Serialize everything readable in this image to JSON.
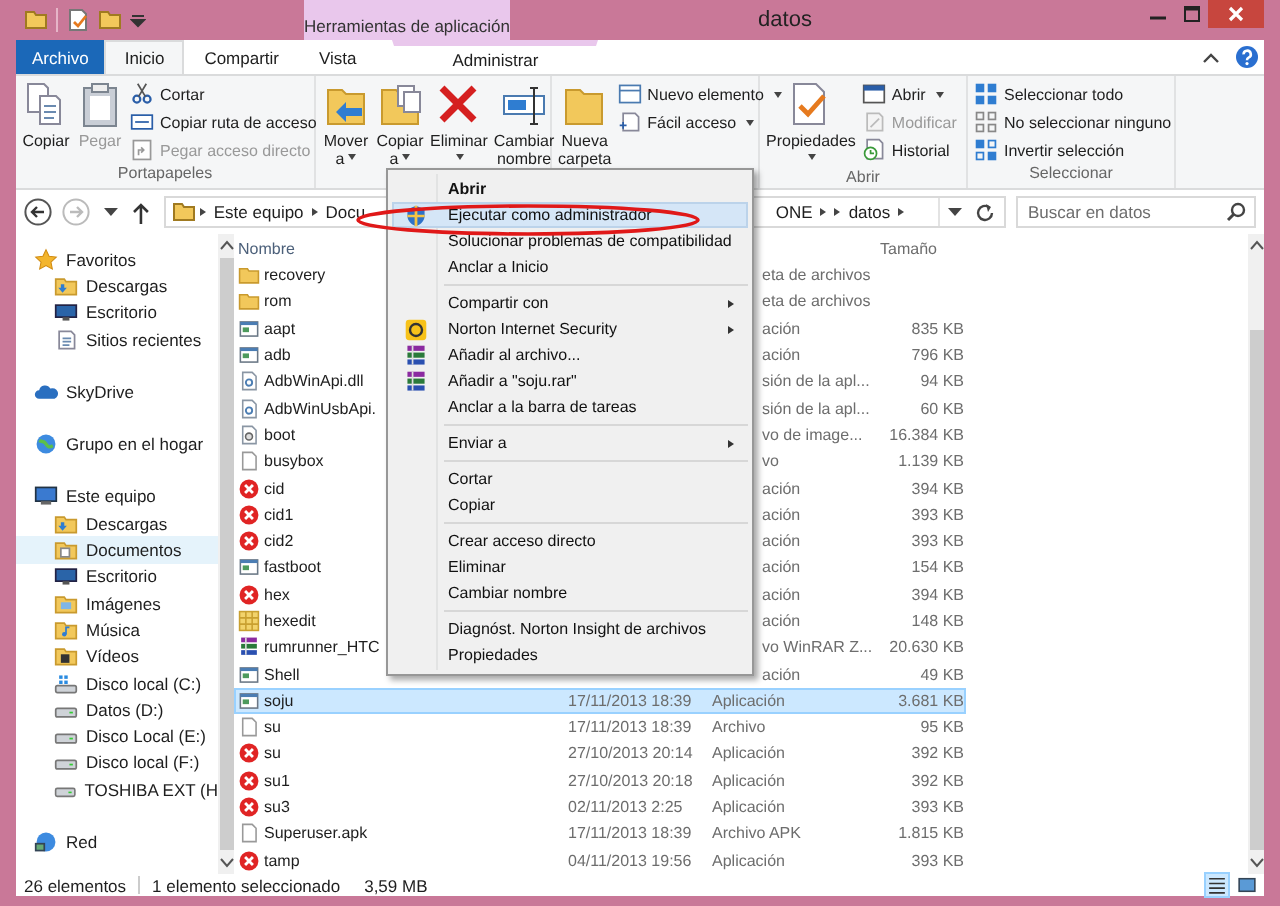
{
  "window": {
    "title": "datos",
    "contextual_tab_group": "Herramientas de aplicación"
  },
  "ribbon_tabs": [
    {
      "label": "Archivo",
      "kind": "file",
      "selected": false
    },
    {
      "label": "Inicio",
      "kind": "tab",
      "selected": true
    },
    {
      "label": "Compartir",
      "kind": "tab",
      "selected": false
    },
    {
      "label": "Vista",
      "kind": "tab",
      "selected": false
    },
    {
      "label": "Administrar",
      "kind": "contextual",
      "selected": false
    }
  ],
  "ribbon_groups": [
    {
      "label": "Portapapeles",
      "large": [
        {
          "kind": "copy",
          "label": "Copiar",
          "dropdown": false,
          "disabled": false
        },
        {
          "kind": "paste",
          "label": "Pegar",
          "dropdown": false,
          "disabled": true
        }
      ],
      "small": [
        {
          "kind": "cut",
          "label": "Cortar",
          "dropdown": false,
          "disabled": false
        },
        {
          "kind": "copy-path",
          "label": "Copiar ruta de acceso",
          "dropdown": false,
          "disabled": false
        },
        {
          "kind": "paste-shortcut",
          "label": "Pegar acceso directo",
          "dropdown": false,
          "disabled": true
        }
      ]
    },
    {
      "large": [
        {
          "kind": "move",
          "label": "Mover a",
          "dropdown": true,
          "disabled": false
        },
        {
          "kind": "copy-to",
          "label": "Copiar a",
          "dropdown": true,
          "disabled": false
        },
        {
          "kind": "delete",
          "label": "Eliminar",
          "dropdown": true,
          "disabled": false
        },
        {
          "kind": "rename",
          "label": "Cambiar nombre",
          "dropdown": false,
          "disabled": false
        }
      ]
    },
    {
      "large": [
        {
          "kind": "new-folder",
          "label": "Nueva carpeta",
          "dropdown": false,
          "disabled": false
        }
      ],
      "small": [
        {
          "kind": "new-item",
          "label": "Nuevo elemento",
          "dropdown": true,
          "disabled": false
        },
        {
          "kind": "easy-access",
          "label": "Fácil acceso",
          "dropdown": true,
          "disabled": false
        }
      ]
    },
    {
      "label": "Abrir",
      "large": [
        {
          "kind": "properties",
          "label": "Propiedades",
          "dropdown": true,
          "disabled": false
        }
      ],
      "small": [
        {
          "kind": "open",
          "label": "Abrir",
          "dropdown": true,
          "disabled": false
        },
        {
          "kind": "edit",
          "label": "Modificar",
          "dropdown": false,
          "disabled": true
        },
        {
          "kind": "history",
          "label": "Historial",
          "dropdown": false,
          "disabled": false
        }
      ]
    },
    {
      "label": "Seleccionar",
      "small": [
        {
          "kind": "select-all",
          "label": "Seleccionar todo",
          "dropdown": false,
          "disabled": false
        },
        {
          "kind": "select-none",
          "label": "No seleccionar ninguno",
          "dropdown": false,
          "disabled": false
        },
        {
          "kind": "invert",
          "label": "Invertir selección",
          "dropdown": false,
          "disabled": false
        }
      ]
    }
  ],
  "address_bar": {
    "crumbs": [
      {
        "label": "Este equipo",
        "resumes_after_menu": false
      },
      {
        "label": "Docu",
        "resumes_after_menu": false
      },
      {
        "label": "ONE",
        "resumes_after_menu": true
      },
      {
        "label": "datos",
        "resumes_after_menu": false
      }
    ]
  },
  "search": {
    "placeholder": "Buscar en datos"
  },
  "nav_tree": [
    {
      "label": "Favoritos",
      "kind": "star",
      "selected": false,
      "children": [
        {
          "label": "Descargas",
          "kind": "downloads",
          "selected": false
        },
        {
          "label": "Escritorio",
          "kind": "desktop",
          "selected": false
        },
        {
          "label": "Sitios recientes",
          "kind": "recent",
          "selected": false
        }
      ]
    },
    {
      "label": "SkyDrive",
      "kind": "cloud",
      "selected": false
    },
    {
      "label": "Grupo en el hogar",
      "kind": "homegroup",
      "selected": false
    },
    {
      "label": "Este equipo",
      "kind": "computer",
      "selected": false,
      "children": [
        {
          "label": "Descargas",
          "kind": "downloads",
          "selected": false
        },
        {
          "label": "Documentos",
          "kind": "documents",
          "selected": true
        },
        {
          "label": "Escritorio",
          "kind": "desktop",
          "selected": false
        },
        {
          "label": "Imágenes",
          "kind": "pictures",
          "selected": false
        },
        {
          "label": "Música",
          "kind": "music",
          "selected": false
        },
        {
          "label": "Vídeos",
          "kind": "videos",
          "selected": false
        },
        {
          "label": "Disco local (C:)",
          "kind": "system-drive",
          "selected": false
        },
        {
          "label": "Datos (D:)",
          "kind": "drive",
          "selected": false
        },
        {
          "label": "Disco Local (E:)",
          "kind": "drive",
          "selected": false
        },
        {
          "label": "Disco local (F:)",
          "kind": "drive",
          "selected": false
        },
        {
          "label": "TOSHIBA EXT (H",
          "kind": "drive",
          "selected": false
        }
      ]
    },
    {
      "label": "Red",
      "kind": "network",
      "selected": false
    }
  ],
  "file_list": {
    "columns": [
      "Nombre",
      "Tamaño"
    ],
    "rows": [
      {
        "name": "recovery",
        "kind": "folder",
        "type": "eta de archivos",
        "type_clipped": true,
        "selected": false
      },
      {
        "name": "rom",
        "kind": "folder",
        "type": "eta de archivos",
        "type_clipped": true,
        "selected": false
      },
      {
        "name": "aapt",
        "kind": "app",
        "type": "ación",
        "type_clipped": true,
        "size": "835 KB",
        "selected": false
      },
      {
        "name": "adb",
        "kind": "app",
        "type": "ación",
        "type_clipped": true,
        "size": "796 KB",
        "selected": false
      },
      {
        "name": "AdbWinApi.dll",
        "kind": "dll",
        "type": "sión de la apl...",
        "type_clipped": true,
        "size": "94 KB",
        "selected": false
      },
      {
        "name": "AdbWinUsbApi.",
        "kind": "dll",
        "type": "sión de la apl...",
        "type_clipped": true,
        "size": "60 KB",
        "selected": false
      },
      {
        "name": "boot",
        "kind": "image",
        "type": "vo de image...",
        "type_clipped": true,
        "size": "16.384 KB",
        "selected": false
      },
      {
        "name": "busybox",
        "kind": "file",
        "type": "vo",
        "type_clipped": true,
        "size": "1.139 KB",
        "selected": false
      },
      {
        "name": "cid",
        "kind": "blocked",
        "type": "ación",
        "type_clipped": true,
        "size": "394 KB",
        "selected": false
      },
      {
        "name": "cid1",
        "kind": "blocked",
        "type": "ación",
        "type_clipped": true,
        "size": "393 KB",
        "selected": false
      },
      {
        "name": "cid2",
        "kind": "blocked",
        "type": "ación",
        "type_clipped": true,
        "size": "393 KB",
        "selected": false
      },
      {
        "name": "fastboot",
        "kind": "app",
        "type": "ación",
        "type_clipped": true,
        "size": "154 KB",
        "selected": false
      },
      {
        "name": "hex",
        "kind": "blocked",
        "type": "ación",
        "type_clipped": true,
        "size": "394 KB",
        "selected": false
      },
      {
        "name": "hexedit",
        "kind": "hexedit",
        "type": "ación",
        "type_clipped": true,
        "size": "148 KB",
        "selected": false
      },
      {
        "name": "rumrunner_HTC",
        "kind": "archive",
        "type": "vo WinRAR Z...",
        "type_clipped": true,
        "size": "20.630 KB",
        "selected": false
      },
      {
        "name": "Shell",
        "kind": "app",
        "type": "ación",
        "type_clipped": true,
        "size": "49 KB",
        "selected": false
      },
      {
        "name": "soju",
        "kind": "app",
        "date": "17/11/2013 18:39",
        "type": "Aplicación",
        "size": "3.681 KB",
        "selected": true
      },
      {
        "name": "su",
        "kind": "file",
        "date": "17/11/2013 18:39",
        "type": "Archivo",
        "size": "95 KB",
        "selected": false
      },
      {
        "name": "su",
        "kind": "blocked",
        "date": "27/10/2013 20:14",
        "type": "Aplicación",
        "size": "392 KB",
        "selected": false
      },
      {
        "name": "su1",
        "kind": "blocked",
        "date": "27/10/2013 20:18",
        "type": "Aplicación",
        "size": "392 KB",
        "selected": false
      },
      {
        "name": "su3",
        "kind": "blocked",
        "date": "02/11/2013 2:25",
        "type": "Aplicación",
        "size": "393 KB",
        "selected": false
      },
      {
        "name": "Superuser.apk",
        "kind": "file",
        "date": "17/11/2013 18:39",
        "type": "Archivo APK",
        "size": "1.815 KB",
        "selected": false
      },
      {
        "name": "tamp",
        "kind": "blocked",
        "date": "04/11/2013 19:56",
        "type": "Aplicación",
        "size": "393 KB",
        "selected": false
      }
    ]
  },
  "status_bar": {
    "count": "26 elementos",
    "selection": "1 elemento seleccionado",
    "selection_size": "3,59 MB",
    "view_buttons": [
      {
        "kind": "details",
        "selected": true
      },
      {
        "kind": "large-icons",
        "selected": false
      }
    ]
  },
  "context_menu": {
    "items": [
      {
        "kind": "command",
        "label": "Abrir",
        "default": true,
        "selected": false,
        "submenu": false
      },
      {
        "kind": "shield",
        "label": "Ejecutar como administrador",
        "default": false,
        "selected": true,
        "submenu": false
      },
      {
        "kind": "command",
        "label": "Solucionar problemas de compatibilidad",
        "default": false,
        "selected": false,
        "submenu": false
      },
      {
        "kind": "command",
        "label": "Anclar a Inicio",
        "default": false,
        "selected": false,
        "submenu": false
      },
      {
        "kind": "separator"
      },
      {
        "kind": "command",
        "label": "Compartir con",
        "default": false,
        "selected": false,
        "submenu": true
      },
      {
        "kind": "norton",
        "label": "Norton Internet Security",
        "default": false,
        "selected": false,
        "submenu": true
      },
      {
        "kind": "archive",
        "label": "Añadir al archivo...",
        "default": false,
        "selected": false,
        "submenu": false
      },
      {
        "kind": "archive",
        "label": "Añadir a \"soju.rar\"",
        "default": false,
        "selected": false,
        "submenu": false
      },
      {
        "kind": "command",
        "label": "Anclar a la barra de tareas",
        "default": false,
        "selected": false,
        "submenu": false
      },
      {
        "kind": "separator"
      },
      {
        "kind": "command",
        "label": "Enviar a",
        "default": false,
        "selected": false,
        "submenu": true
      },
      {
        "kind": "separator"
      },
      {
        "kind": "command",
        "label": "Cortar",
        "default": false,
        "selected": false,
        "submenu": false
      },
      {
        "kind": "command",
        "label": "Copiar",
        "default": false,
        "selected": false,
        "submenu": false
      },
      {
        "kind": "separator"
      },
      {
        "kind": "command",
        "label": "Crear acceso directo",
        "default": false,
        "selected": false,
        "submenu": false
      },
      {
        "kind": "command",
        "label": "Eliminar",
        "default": false,
        "selected": false,
        "submenu": false
      },
      {
        "kind": "command",
        "label": "Cambiar nombre",
        "default": false,
        "selected": false,
        "submenu": false
      },
      {
        "kind": "separator"
      },
      {
        "kind": "command",
        "label": "Diagnóst. Norton Insight de archivos",
        "default": false,
        "selected": false,
        "submenu": false
      },
      {
        "kind": "command",
        "label": "Propiedades",
        "default": false,
        "selected": false,
        "submenu": false
      }
    ],
    "annotation": {
      "kind": "ellipse"
    }
  }
}
